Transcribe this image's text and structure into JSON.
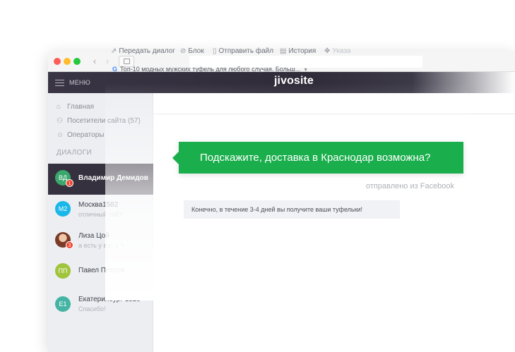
{
  "topbar": {
    "menu_label": "МЕНЮ",
    "logo": "jivosite"
  },
  "sidebar": {
    "nav": [
      {
        "label": "Главная",
        "icon": "home-icon"
      },
      {
        "label": "Посетители сайта (57)",
        "icon": "users-icon"
      },
      {
        "label": "Операторы",
        "icon": "user-icon"
      }
    ],
    "section_label": "ДИАЛОГИ",
    "chats": [
      {
        "initials": "ВД",
        "name": "Владимир Демидов",
        "preview": "",
        "badge": "1",
        "avatar_color": "#3aa76d",
        "active": true
      },
      {
        "initials": "М2",
        "name": "Москва1582",
        "preview": "отличный сайт!",
        "badge": "",
        "avatar_color": "#1ab7e8"
      },
      {
        "initials": "",
        "name": "Лиза Цой",
        "preview": "а есть у вас з",
        "badge": "3",
        "avatar_color": "photo"
      },
      {
        "initials": "ПП",
        "name": "Павел Петров",
        "preview": "",
        "badge": "",
        "avatar_color": "#a0c43c"
      },
      {
        "initials": "Е1",
        "name": "Екатеринбург 1529",
        "preview": "Спасибо!",
        "badge": "",
        "avatar_color": "#46b4a4"
      }
    ]
  },
  "toolbar": {
    "items": [
      {
        "label": "Передать диалог",
        "icon": "forward-icon"
      },
      {
        "label": "Блок",
        "icon": "block-icon"
      },
      {
        "label": "Отправить файл",
        "icon": "file-icon"
      },
      {
        "label": "История",
        "icon": "history-icon"
      },
      {
        "label": "Указа",
        "icon": "pointer-icon"
      }
    ]
  },
  "ad": {
    "source_icon": "G",
    "text": "Топ-10 модных мужских туфель для любого случая. Больш..."
  },
  "messages": {
    "visitor": "Подскажите, доставка в Краснодар возможна?",
    "sent_from": "отправлено из Facebook",
    "operator": "Конечно, в течение 3-4 дней вы получите ваши туфельки!"
  },
  "colors": {
    "accent_green": "#1aaf4c",
    "topbar_dark": "#2f2b38",
    "badge_red": "#f0452f"
  }
}
